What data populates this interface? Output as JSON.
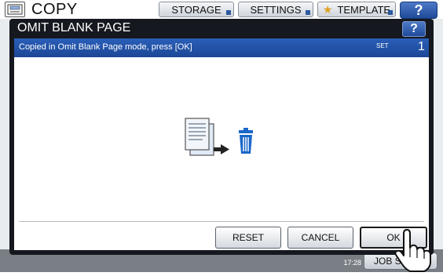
{
  "app": {
    "title": "COPY"
  },
  "top_tabs": [
    {
      "label": "STORAGE"
    },
    {
      "label": "SETTINGS"
    },
    {
      "label": "TEMPLATE"
    }
  ],
  "help_label": "?",
  "dialog": {
    "title": "OMIT BLANK PAGE",
    "message": "Copied in Omit Blank Page mode, press [OK]",
    "set_label": "SET",
    "set_count": "1",
    "buttons": {
      "reset": "RESET",
      "cancel": "CANCEL",
      "ok": "OK"
    }
  },
  "status": {
    "time": "17:28",
    "job_status_label": "JOB S"
  },
  "icons": [
    "copy-icon",
    "help-icon",
    "document-icon",
    "arrow-icon",
    "trash-icon",
    "star-icon",
    "hand-pointer-icon"
  ],
  "colors": {
    "dialog_frame": "#15181e",
    "message_bar": "#2a5fb8",
    "trash": "#1a67c8"
  }
}
